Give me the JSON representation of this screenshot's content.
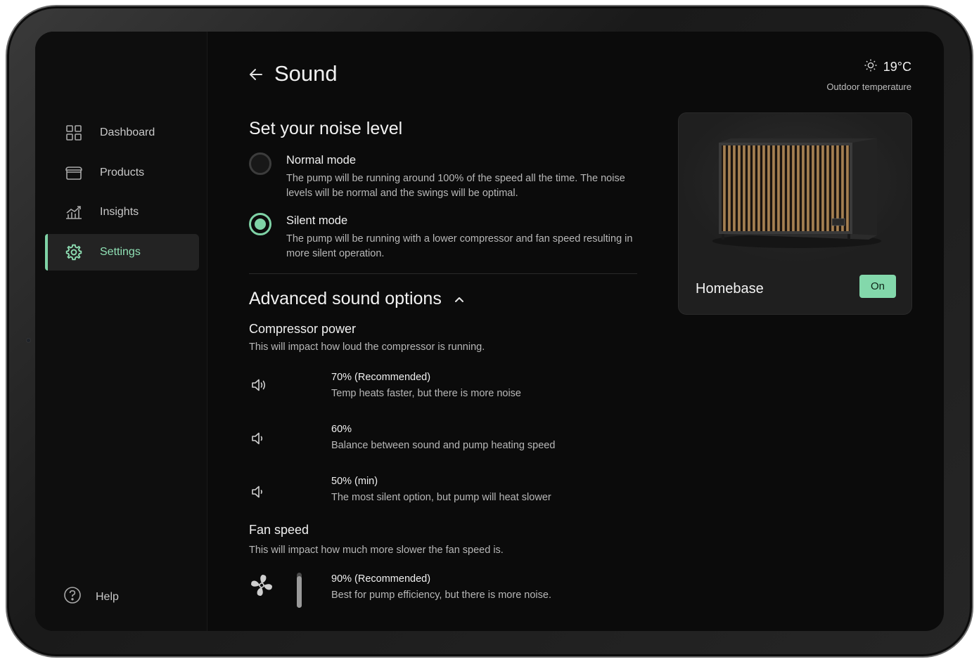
{
  "header": {
    "title": "Sound",
    "temperature": "19°C",
    "temperature_label": "Outdoor temperature"
  },
  "sidebar": {
    "items": [
      {
        "label": "Dashboard",
        "icon": "grid-icon"
      },
      {
        "label": "Products",
        "icon": "box-icon"
      },
      {
        "label": "Insights",
        "icon": "chart-icon"
      },
      {
        "label": "Settings",
        "icon": "gear-icon",
        "active": true
      }
    ],
    "help_label": "Help"
  },
  "noise": {
    "heading": "Set your noise level",
    "modes": [
      {
        "title": "Normal mode",
        "description": "The pump will be running around 100% of the speed all the time. The noise levels will be normal and the swings will be optimal.",
        "selected": false
      },
      {
        "title": "Silent mode",
        "description": "The pump will be running with a lower compressor and fan speed resulting in more silent operation.",
        "selected": true
      }
    ]
  },
  "advanced": {
    "heading": "Advanced sound options",
    "compressor": {
      "title": "Compressor power",
      "subtitle": "This will impact how loud the compressor is running.",
      "options": [
        {
          "title": "70% (Recommended)",
          "description": "Temp heats faster, but there is more noise",
          "icon": "volume-high-icon"
        },
        {
          "title": "60%",
          "description": "Balance between sound and pump heating speed",
          "icon": "volume-medium-icon"
        },
        {
          "title": "50% (min)",
          "description": "The most silent option, but pump will heat slower",
          "icon": "volume-low-icon"
        }
      ]
    },
    "fan": {
      "title": "Fan speed",
      "subtitle": "This will impact how much more slower the fan speed is.",
      "option_title": "90% (Recommended)",
      "option_description": "Best for pump efficiency, but there is more noise.",
      "level": 0.9
    }
  },
  "product": {
    "name": "Homebase",
    "status": "On"
  },
  "colors": {
    "accent": "#7fd3a6",
    "background": "#0b0b0b",
    "card": "#1f1f1f"
  }
}
